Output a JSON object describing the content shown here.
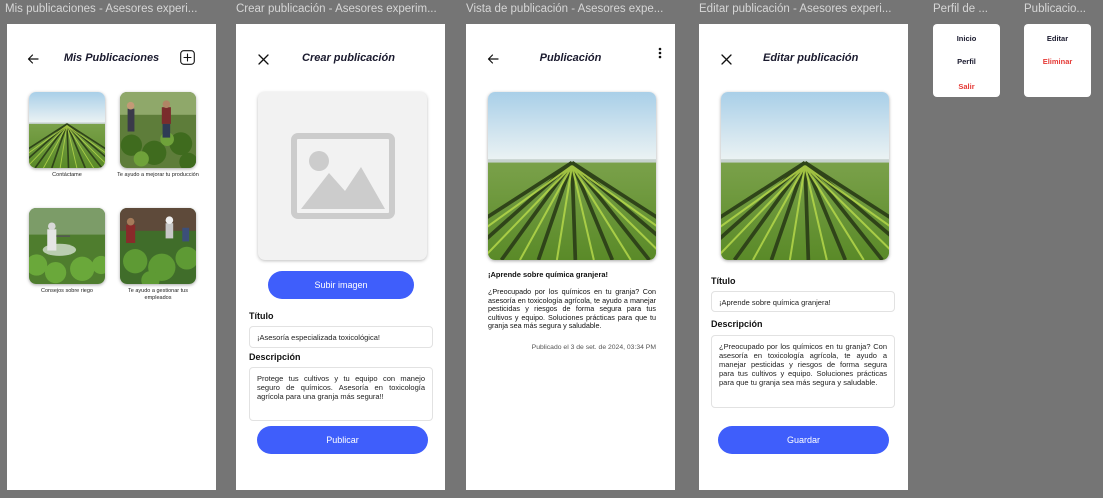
{
  "colors": {
    "accent": "#3f5efb",
    "danger": "#e53935",
    "canvas": "#757575"
  },
  "frames": {
    "mis_publicaciones": "Mis publicaciones - Asesores experi...",
    "crear": "Crear publicación - Asesores experim...",
    "vista": "Vista de publicación - Asesores expe...",
    "editar": "Editar publicación - Asesores experi...",
    "perfil": "Perfil de ...",
    "publicacion_menu": "Publicacio..."
  },
  "screen1": {
    "back_icon": "arrow-left-icon",
    "title": "Mis Publicaciones",
    "add_icon": "plus-square-icon",
    "posts": [
      {
        "caption": "Contáctame"
      },
      {
        "caption": "Te ayudo a mejorar tu producción"
      },
      {
        "caption": "Consejos sobre riego"
      },
      {
        "caption": "Te ayudo a gestionar tus empleados"
      }
    ]
  },
  "screen2": {
    "close_icon": "close-icon",
    "title": "Crear publicación",
    "image_placeholder_icon": "image-placeholder-icon",
    "upload_label": "Subir imagen",
    "title_label": "Título",
    "title_value": "¡Asesoría especializada toxicológica!",
    "desc_label": "Descripción",
    "desc_value": "Protege tus cultivos y tu equipo con manejo seguro de químicos. Asesoría en toxicología agrícola para una granja más segura!!",
    "publish_label": "Publicar"
  },
  "screen3": {
    "back_icon": "arrow-left-icon",
    "title": "Publicación",
    "more_icon": "more-vertical-icon",
    "post_title": "¡Aprende sobre química granjera!",
    "post_body": "¿Preocupado por los químicos en tu granja? Con asesoría en toxicología agrícola, te ayudo a manejar pesticidas y riesgos de forma segura para tus cultivos y equipo. Soluciones prácticas para que tu granja sea más segura y saludable.",
    "published": "Publicado el 3 de set. de 2024, 03:34 PM"
  },
  "screen4": {
    "close_icon": "close-icon",
    "title": "Editar publicación",
    "title_label": "Título",
    "title_value": "¡Aprende sobre química granjera!",
    "desc_label": "Descripción",
    "desc_value": "¿Preocupado por los químicos en tu granja? Con asesoría en toxicología agrícola, te ayudo a manejar pesticidas y riesgos de forma segura para tus cultivos y equipo. Soluciones prácticas para que tu granja sea más segura y saludable.",
    "save_label": "Guardar"
  },
  "perfil_menu": {
    "items": [
      "Inicio",
      "Perfil",
      "Salir"
    ]
  },
  "post_menu": {
    "items": [
      "Editar",
      "Eliminar"
    ]
  }
}
